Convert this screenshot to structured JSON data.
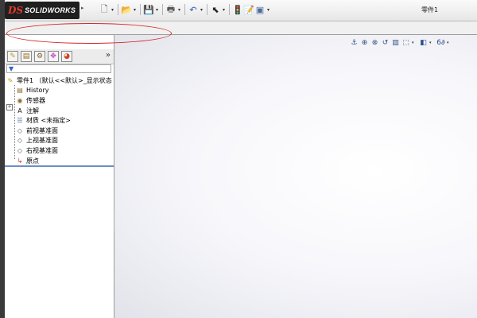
{
  "app": {
    "logo_mark": "DS",
    "logo_text": "SOLIDWORKS",
    "document_title": "零件1"
  },
  "toolbar": {
    "buttons": [
      {
        "name": "new-document",
        "icon": "new-document-icon",
        "glyph": "🗋",
        "color": "#444444",
        "dropdown": true
      },
      {
        "name": "open",
        "icon": "open-folder-icon",
        "glyph": "📂",
        "color": "#d6a21a",
        "dropdown": true
      },
      {
        "name": "save",
        "icon": "save-icon",
        "glyph": "💾",
        "color": "#2c5bb0",
        "dropdown": true
      },
      {
        "name": "print",
        "icon": "print-icon",
        "glyph": "🖶",
        "color": "#555555",
        "dropdown": true
      },
      {
        "name": "undo",
        "icon": "undo-icon",
        "glyph": "↶",
        "color": "#2b5aa8",
        "dropdown": true
      },
      {
        "name": "select",
        "icon": "select-pointer-icon",
        "glyph": "⬉",
        "color": "#222222",
        "dropdown": true
      },
      {
        "name": "rebuild",
        "icon": "rebuild-traffic-light-icon",
        "glyph": "🚦",
        "color": "#c0392b",
        "dropdown": false
      },
      {
        "name": "file-properties",
        "icon": "file-properties-icon",
        "glyph": "📝",
        "color": "#8a6d2c",
        "dropdown": false
      },
      {
        "name": "options",
        "icon": "options-icon",
        "glyph": "▣",
        "color": "#4a6a9a",
        "dropdown": true
      }
    ]
  },
  "feature_manager": {
    "tabs": [
      {
        "name": "feature-manager-tab",
        "icon": "feature-tree-icon",
        "glyph": "✎",
        "color": "#c49a1a"
      },
      {
        "name": "property-manager-tab",
        "icon": "property-manager-icon",
        "glyph": "▤",
        "color": "#9b6b20"
      },
      {
        "name": "configuration-manager-tab",
        "icon": "configuration-icon",
        "glyph": "⚙",
        "color": "#7a5a20"
      },
      {
        "name": "dimxpert-tab",
        "icon": "dimxpert-icon",
        "glyph": "✥",
        "color": "#c13ac1"
      },
      {
        "name": "display-manager-tab",
        "icon": "display-manager-icon",
        "glyph": "◕",
        "color": "#d6401c"
      }
    ],
    "expand_glyph": "»",
    "filter_glyph": "▼",
    "tree": [
      {
        "name": "tree-root-part",
        "icon": "part-icon",
        "glyph": "✎",
        "color": "#c49a1a",
        "label": "零件1 （默认<<默认>_显示状态"
      },
      {
        "name": "tree-history",
        "icon": "history-icon",
        "glyph": "▤",
        "color": "#8a6d2c",
        "label": "History"
      },
      {
        "name": "tree-sensors",
        "icon": "sensors-icon",
        "glyph": "◉",
        "color": "#8a6d2c",
        "label": "传感器"
      },
      {
        "name": "tree-annotations",
        "icon": "annotations-icon",
        "glyph": "A",
        "color": "#1a1a1a",
        "label": "注解"
      },
      {
        "name": "tree-material",
        "icon": "material-icon",
        "glyph": "☰",
        "color": "#4a6a9a",
        "label": "材质 <未指定>"
      },
      {
        "name": "tree-front-plane",
        "icon": "plane-icon",
        "glyph": "◇",
        "color": "#555555",
        "label": "前视基准面"
      },
      {
        "name": "tree-top-plane",
        "icon": "plane-icon",
        "glyph": "◇",
        "color": "#555555",
        "label": "上视基准面"
      },
      {
        "name": "tree-right-plane",
        "icon": "plane-icon",
        "glyph": "◇",
        "color": "#555555",
        "label": "右视基准面"
      },
      {
        "name": "tree-origin",
        "icon": "origin-icon",
        "glyph": "↳",
        "color": "#c0392b",
        "label": "原点"
      }
    ]
  },
  "heads_up_toolbar": [
    {
      "name": "view-orientation-button",
      "icon": "view-orientation-icon",
      "glyph": "⚓",
      "dropdown": false
    },
    {
      "name": "zoom-to-fit-button",
      "icon": "zoom-to-fit-icon",
      "glyph": "⊕",
      "dropdown": false
    },
    {
      "name": "zoom-area-button",
      "icon": "zoom-area-icon",
      "glyph": "⊗",
      "dropdown": false
    },
    {
      "name": "previous-view-button",
      "icon": "previous-view-icon",
      "glyph": "↺",
      "dropdown": false
    },
    {
      "name": "section-view-button",
      "icon": "section-view-icon",
      "glyph": "▥",
      "dropdown": false
    },
    {
      "name": "view-orientation-menu-button",
      "icon": "cube-view-icon",
      "glyph": "⬚",
      "dropdown": true
    },
    {
      "name": "display-style-button",
      "icon": "display-style-icon",
      "glyph": "◧",
      "dropdown": true
    },
    {
      "name": "hide-show-items-button",
      "icon": "hide-show-icon",
      "glyph": "6∂",
      "dropdown": true
    }
  ],
  "colors": {
    "annotation_ellipse": "#d62424",
    "logo_background": "#1f1f1f",
    "logo_mark": "#e03c31"
  }
}
